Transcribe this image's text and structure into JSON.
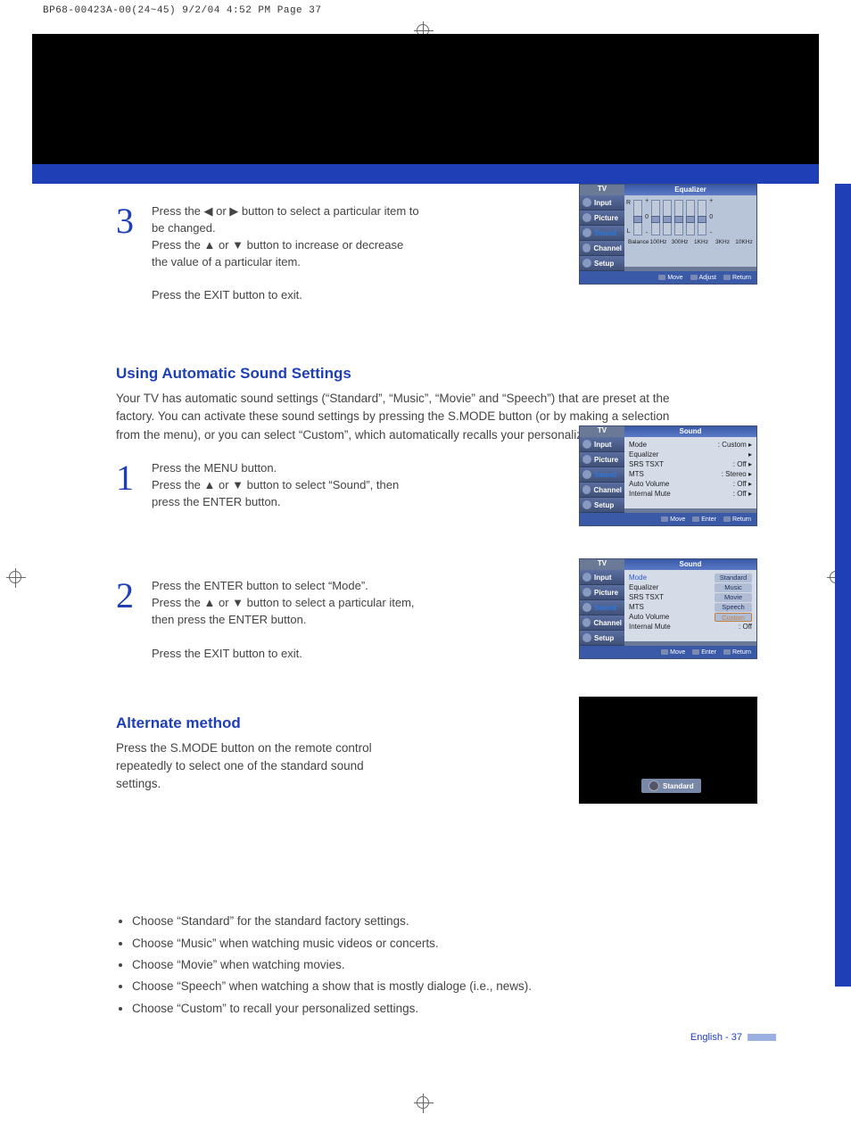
{
  "header": "BP68-00423A-00(24~45)  9/2/04  4:52 PM  Page 37",
  "step3": {
    "num": "3",
    "line1": "Press the ◀ or ▶ button to select a particular item to be changed.",
    "line2": "Press the ▲ or ▼ button to increase or decrease the value of a particular item.",
    "line3": "Press the EXIT button to exit."
  },
  "osd_eq": {
    "tv": "TV",
    "title": "Equalizer",
    "side": [
      "Input",
      "Picture",
      "Sound",
      "Channel",
      "Setup"
    ],
    "r": "R",
    "l": "L",
    "plus": "+",
    "minus": "-",
    "zero": "0",
    "bands": [
      "Balance",
      "100Hz",
      "300Hz",
      "1KHz",
      "3KHz",
      "10KHz"
    ],
    "footer": [
      "Move",
      "Adjust",
      "Return"
    ]
  },
  "section1": {
    "title": "Using Automatic Sound Settings",
    "body": "Your TV has automatic sound settings (“Standard”, “Music”, “Movie” and “Speech”) that are preset at the factory. You can activate these sound settings by pressing the S.MODE button (or by making a selection from the menu), or you can select “Custom”, which automatically recalls your personalized sound settings."
  },
  "step1": {
    "num": "1",
    "line1": "Press the MENU button.",
    "line2": "Press the ▲ or ▼ button to select “Sound”, then press the ENTER button."
  },
  "osd_sound1": {
    "tv": "TV",
    "title": "Sound",
    "side": [
      "Input",
      "Picture",
      "Sound",
      "Channel",
      "Setup"
    ],
    "rows": [
      {
        "l": "Mode",
        "r": ": Custom"
      },
      {
        "l": "Equalizer",
        "r": ""
      },
      {
        "l": "SRS TSXT",
        "r": ": Off"
      },
      {
        "l": "MTS",
        "r": ": Stereo"
      },
      {
        "l": "Auto Volume",
        "r": ": Off"
      },
      {
        "l": "Internal Mute",
        "r": ": Off"
      }
    ],
    "footer": [
      "Move",
      "Enter",
      "Return"
    ]
  },
  "step2": {
    "num": "2",
    "line1": "Press the ENTER button to select “Mode”.",
    "line2": "Press the ▲ or ▼ button to select a particular item, then press the ENTER button.",
    "line3": "Press the EXIT button to exit."
  },
  "osd_sound2": {
    "tv": "TV",
    "title": "Sound",
    "side": [
      "Input",
      "Picture",
      "Sound",
      "Channel",
      "Setup"
    ],
    "rows": [
      {
        "l": "Mode",
        "r": ""
      },
      {
        "l": "Equalizer",
        "r": ""
      },
      {
        "l": "SRS TSXT",
        "r": ""
      },
      {
        "l": "MTS",
        "r": ""
      },
      {
        "l": "Auto Volume",
        "r": ""
      },
      {
        "l": "Internal Mute",
        "r": ": Off"
      }
    ],
    "opts": [
      "Standard",
      "Music",
      "Movie",
      "Speech",
      "Custom"
    ],
    "footer": [
      "Move",
      "Enter",
      "Return"
    ]
  },
  "section2": {
    "title": "Alternate method",
    "body": "Press the S.MODE button on the remote control repeatedly to select one of the standard sound settings."
  },
  "osd_alt": {
    "label": "Standard"
  },
  "bullets": [
    "Choose “Standard” for the standard factory settings.",
    "Choose “Music” when watching music videos or concerts.",
    "Choose “Movie” when watching movies.",
    "Choose “Speech” when watching a show that is mostly dialoge (i.e., news).",
    "Choose “Custom” to recall your personalized settings."
  ],
  "pagefoot": "English - 37"
}
